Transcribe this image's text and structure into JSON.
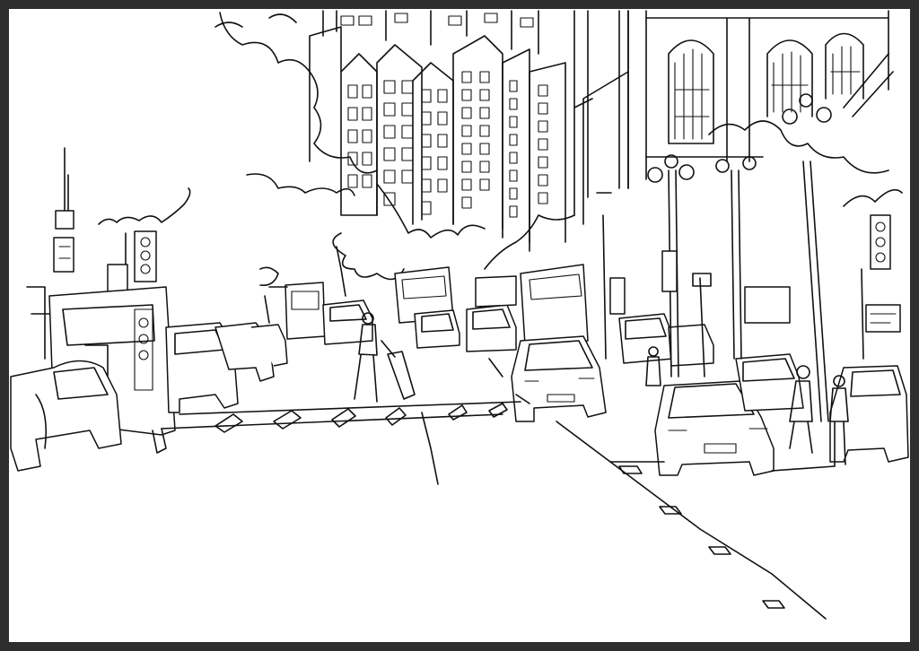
{
  "artwork": {
    "frame_color": "#2e2e2e",
    "paper_color": "#ffffff",
    "ink_color": "#111111",
    "style": "single-line ink drawing",
    "sign_text": "",
    "subjects": [
      "buildings",
      "trees",
      "traffic-lights",
      "street-lamps",
      "cars",
      "bus",
      "pedestrians",
      "crosswalk",
      "road"
    ]
  }
}
